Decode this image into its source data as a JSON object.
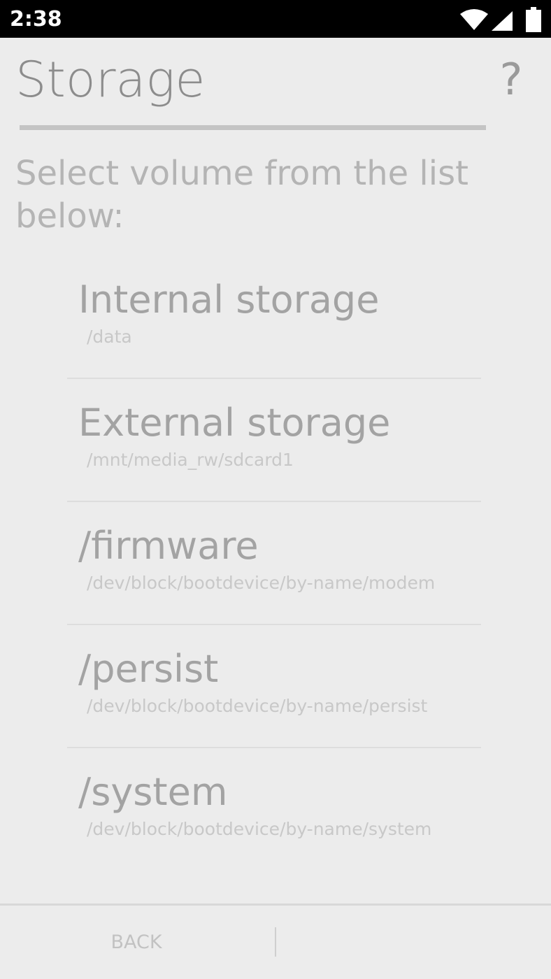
{
  "status_bar": {
    "time": "2:38",
    "icons": [
      "wifi-icon",
      "signal-icon",
      "battery-icon"
    ],
    "background": "#000000"
  },
  "header": {
    "title": "Storage",
    "help_label": "?"
  },
  "instruction": "Select volume from the list below:",
  "volumes": [
    {
      "name": "Internal storage",
      "path": "/data"
    },
    {
      "name": "External storage",
      "path": "/mnt/media_rw/sdcard1"
    },
    {
      "name": "/firmware",
      "path": "/dev/block/bootdevice/by-name/modem"
    },
    {
      "name": "/persist",
      "path": "/dev/block/bootdevice/by-name/persist"
    },
    {
      "name": "/system",
      "path": "/dev/block/bootdevice/by-name/system"
    }
  ],
  "footer": {
    "back_label": "BACK"
  },
  "colors": {
    "background": "#ececec",
    "title_text": "#8c8c8c",
    "item_text": "#a3a3a3",
    "path_text": "#c8c8c8"
  }
}
